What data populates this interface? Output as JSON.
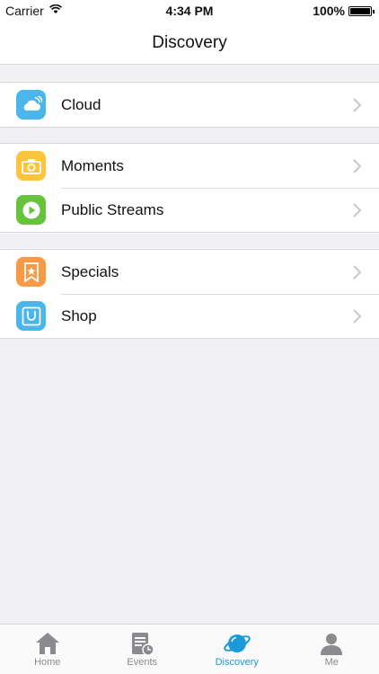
{
  "status_bar": {
    "carrier": "Carrier",
    "time": "4:34 PM",
    "battery": "100%"
  },
  "nav": {
    "title": "Discovery"
  },
  "groups": [
    {
      "items": [
        {
          "label": "Cloud",
          "icon": "cloud-icon",
          "color": "#4ab6ea"
        }
      ]
    },
    {
      "items": [
        {
          "label": "Moments",
          "icon": "camera-icon",
          "color": "#fcc43d"
        },
        {
          "label": "Public Streams",
          "icon": "play-icon",
          "color": "#65c43c"
        }
      ]
    },
    {
      "items": [
        {
          "label": "Specials",
          "icon": "star-bookmark-icon",
          "color": "#f89a45"
        },
        {
          "label": "Shop",
          "icon": "shopping-bag-icon",
          "color": "#4ab6ea"
        }
      ]
    }
  ],
  "tabs": [
    {
      "label": "Home",
      "icon": "home-icon",
      "active": false
    },
    {
      "label": "Events",
      "icon": "events-icon",
      "active": false
    },
    {
      "label": "Discovery",
      "icon": "planet-icon",
      "active": true
    },
    {
      "label": "Me",
      "icon": "person-icon",
      "active": false
    }
  ],
  "colors": {
    "accent": "#1a9ad9",
    "background": "#f1f1f4"
  }
}
